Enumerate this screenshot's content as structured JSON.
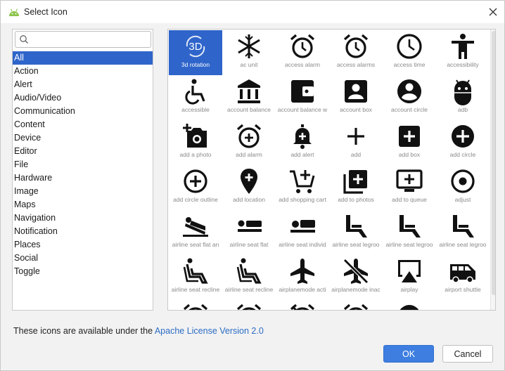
{
  "window": {
    "title": "Select Icon"
  },
  "search": {
    "value": "",
    "placeholder": ""
  },
  "categories": [
    "All",
    "Action",
    "Alert",
    "Audio/Video",
    "Communication",
    "Content",
    "Device",
    "Editor",
    "File",
    "Hardware",
    "Image",
    "Maps",
    "Navigation",
    "Notification",
    "Places",
    "Social",
    "Toggle"
  ],
  "selected_category": "All",
  "icons": [
    {
      "name": "3d rotation",
      "icon": "3d-rotation-icon"
    },
    {
      "name": "ac unit",
      "icon": "snowflake-icon"
    },
    {
      "name": "access alarm",
      "icon": "alarm-icon"
    },
    {
      "name": "access alarms",
      "icon": "alarm-icon"
    },
    {
      "name": "access time",
      "icon": "clock-icon"
    },
    {
      "name": "accessibility",
      "icon": "person-icon"
    },
    {
      "name": "accessible",
      "icon": "wheelchair-icon"
    },
    {
      "name": "account balance",
      "icon": "bank-icon"
    },
    {
      "name": "account balance w",
      "icon": "wallet-icon"
    },
    {
      "name": "account box",
      "icon": "account-box-icon"
    },
    {
      "name": "account circle",
      "icon": "account-circle-icon"
    },
    {
      "name": "adb",
      "icon": "android-icon"
    },
    {
      "name": "add a photo",
      "icon": "add-photo-icon"
    },
    {
      "name": "add alarm",
      "icon": "add-alarm-icon"
    },
    {
      "name": "add alert",
      "icon": "bell-plus-icon"
    },
    {
      "name": "add",
      "icon": "plus-icon"
    },
    {
      "name": "add box",
      "icon": "add-box-icon"
    },
    {
      "name": "add circle",
      "icon": "add-circle-icon"
    },
    {
      "name": "add circle outline",
      "icon": "add-circle-outline-icon"
    },
    {
      "name": "add location",
      "icon": "add-location-icon"
    },
    {
      "name": "add shopping cart",
      "icon": "cart-plus-icon"
    },
    {
      "name": "add to photos",
      "icon": "add-to-photos-icon"
    },
    {
      "name": "add to queue",
      "icon": "add-to-queue-icon"
    },
    {
      "name": "adjust",
      "icon": "adjust-icon"
    },
    {
      "name": "airline seat flat an",
      "icon": "seat-flat-angled-icon"
    },
    {
      "name": "airline seat flat",
      "icon": "seat-flat-icon"
    },
    {
      "name": "airline seat individ",
      "icon": "seat-individual-icon"
    },
    {
      "name": "airline seat legroo",
      "icon": "seat-legroom-icon"
    },
    {
      "name": "airline seat legroo",
      "icon": "seat-legroom-icon"
    },
    {
      "name": "airline seat legroo",
      "icon": "seat-legroom-icon"
    },
    {
      "name": "airline seat recline",
      "icon": "seat-recline-icon"
    },
    {
      "name": "airline seat recline",
      "icon": "seat-recline-icon"
    },
    {
      "name": "airplanemode acti",
      "icon": "airplane-icon"
    },
    {
      "name": "airplanemode inac",
      "icon": "airplane-off-icon"
    },
    {
      "name": "airplay",
      "icon": "airplay-icon"
    },
    {
      "name": "airport shuttle",
      "icon": "shuttle-icon"
    },
    {
      "name": "",
      "icon": "alarm-icon"
    },
    {
      "name": "",
      "icon": "alarm-icon"
    },
    {
      "name": "",
      "icon": "alarm-off-icon"
    },
    {
      "name": "",
      "icon": "alarm-icon"
    },
    {
      "name": "",
      "icon": "circle-icon"
    },
    {
      "name": "",
      "icon": "circles-icon"
    }
  ],
  "footer": {
    "license_text": "These icons are available under the ",
    "license_link": "Apache License Version 2.0",
    "ok_label": "OK",
    "cancel_label": "Cancel"
  },
  "colors": {
    "selection": "#2f65ca",
    "ok_button": "#3d7ee0",
    "link": "#2b6cc4",
    "icon": "#111111"
  }
}
